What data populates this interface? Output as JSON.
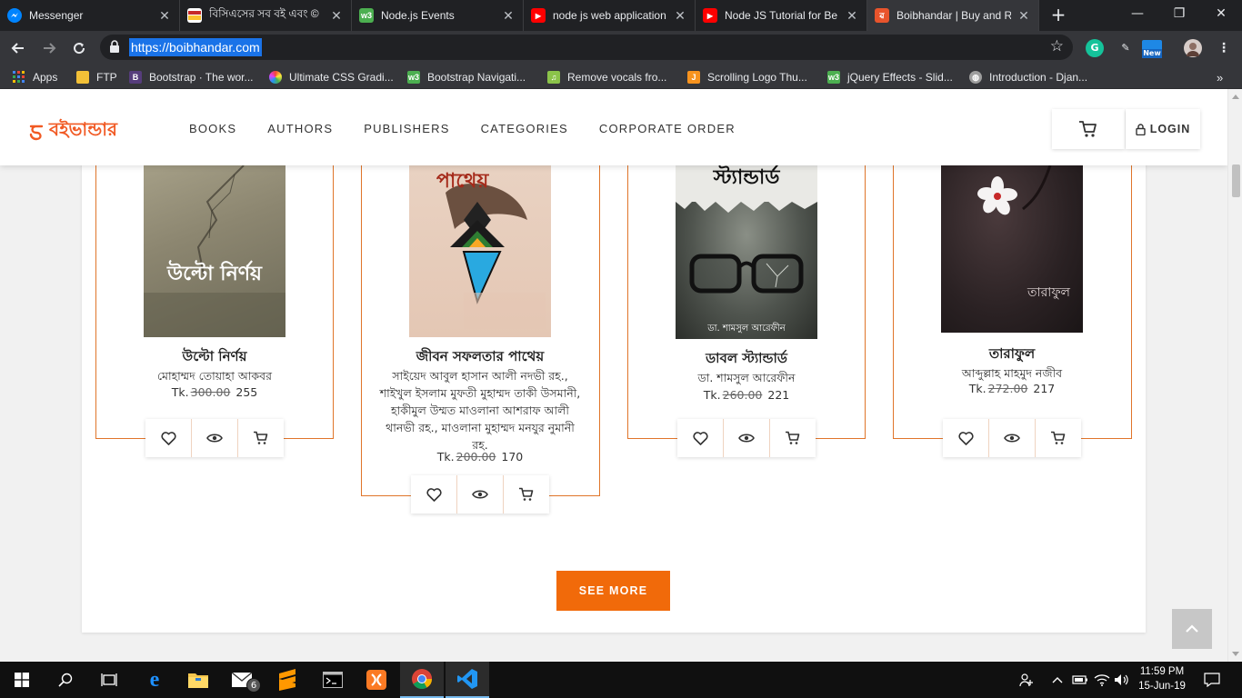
{
  "browser": {
    "tabs": [
      {
        "title": "Messenger",
        "favicon_color": "#0084ff",
        "favicon_text": ""
      },
      {
        "title": "বিসিএসের সব বই এবং ©",
        "favicon_color": "#ffffff",
        "favicon_text": ""
      },
      {
        "title": "Node.js Events",
        "favicon_color": "#4caf50",
        "favicon_text": "w3"
      },
      {
        "title": "node js web application",
        "favicon_color": "#ff0000",
        "favicon_text": "▶"
      },
      {
        "title": "Node JS Tutorial for Be",
        "favicon_color": "#ff0000",
        "favicon_text": "▶"
      },
      {
        "title": "Boibhandar | Buy and R",
        "favicon_color": "#e8542c",
        "favicon_text": "ৱ"
      }
    ],
    "url": "https://boibhandar.com",
    "bookmarks": [
      {
        "label": "Apps",
        "color": "#e8eaed",
        "text": "⋮⋮"
      },
      {
        "label": "FTP",
        "color": "#f2c037",
        "text": ""
      },
      {
        "label": "Bootstrap · The wor...",
        "color": "#563d7c",
        "text": "B"
      },
      {
        "label": "Ultimate CSS Gradi...",
        "color": "#e040fb",
        "text": ""
      },
      {
        "label": "Bootstrap Navigati...",
        "color": "#4caf50",
        "text": "w3"
      },
      {
        "label": "Remove vocals fro...",
        "color": "#8bc34a",
        "text": "♫"
      },
      {
        "label": "Scrolling Logo Thu...",
        "color": "#f7931e",
        "text": "J"
      },
      {
        "label": "jQuery Effects - Slid...",
        "color": "#4caf50",
        "text": "w3"
      },
      {
        "label": "Introduction - Djan...",
        "color": "#9e9e9e",
        "text": "◍"
      }
    ],
    "extension_new_label": "New"
  },
  "site": {
    "logo_text": "বইভান্ডার",
    "brand_color": "#f15a24",
    "menu": [
      "BOOKS",
      "AUTHORS",
      "PUBLISHERS",
      "CATEGORIES",
      "CORPORATE ORDER"
    ],
    "login_label": "LOGIN",
    "currency": "Tk.",
    "see_more_label": "SEE MORE"
  },
  "books": [
    {
      "title": "উল্টো নির্ণয়",
      "author": "মোহাম্মদ তোয়াহা আকবর",
      "old_price": "300.00",
      "price": "255",
      "cover_title": "উল্টো নির্ণয়"
    },
    {
      "title": "জীবন সফলতার পাথেয়",
      "author": "সাইয়েদ আবুল হাসান আলী নদভী রহ., শাইখুল ইসলাম মুফতী মুহাম্মদ তাকী উসমানী, হাকীমুল উম্মত মাওলানা আশরাফ আলী থানভী রহ., মাওলানা মুহাম্মদ মনযুর নুমানী রহ.",
      "old_price": "200.00",
      "price": "170",
      "cover_title": "পাথেয়"
    },
    {
      "title": "ডাবল স্ট্যান্ডার্ড",
      "author": "ডা. শামসুল আরেফীন",
      "old_price": "260.00",
      "price": "221",
      "cover_title": "স্ট্যান্ডার্ড",
      "cover_author": "ডা. শামসুল আরেফীন"
    },
    {
      "title": "তারাফুল",
      "author": "আব্দুল্লাহ মাহমুদ নজীব",
      "old_price": "272.00",
      "price": "217",
      "cover_title": "তারাফুল"
    }
  ],
  "taskbar": {
    "time": "11:59 PM",
    "date": "15-Jun-19",
    "mail_badge": "6"
  }
}
